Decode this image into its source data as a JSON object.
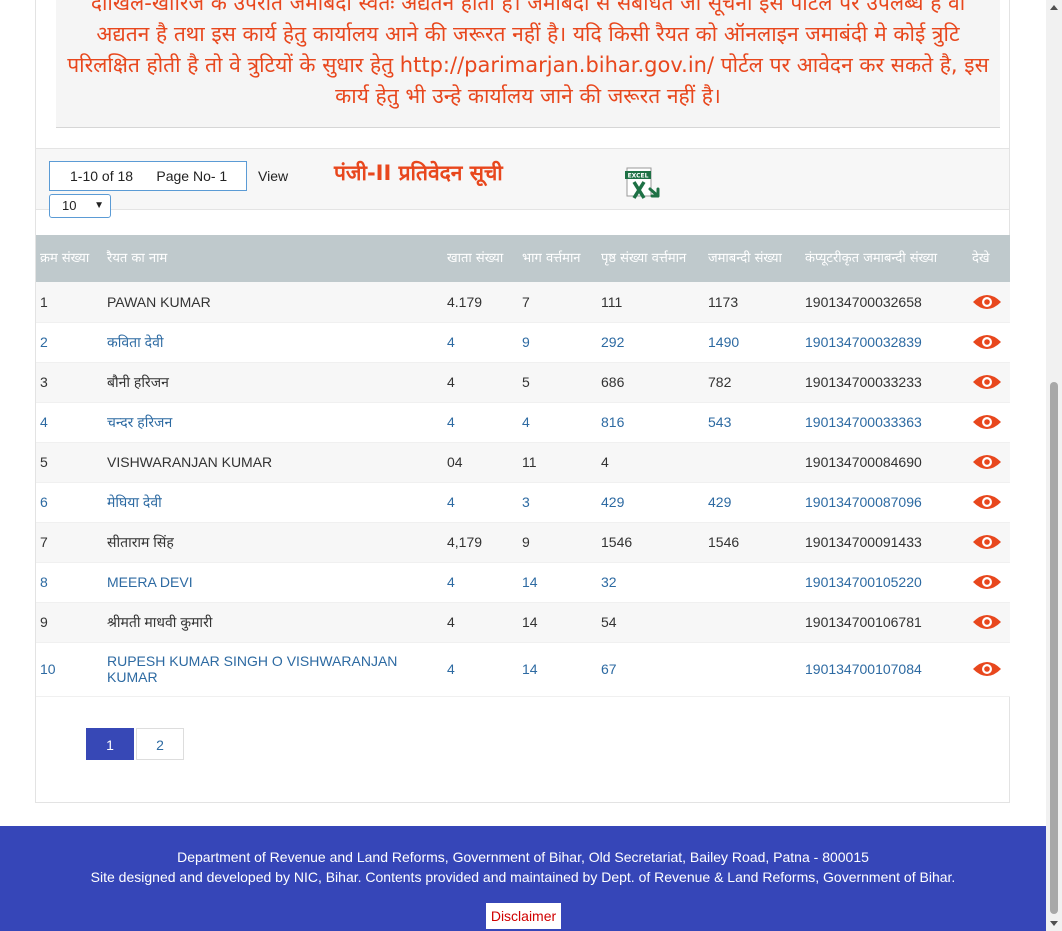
{
  "notice": {
    "text": "दाखिल-खारिज के उपरांत जमाबंदी स्वतः अद्यतन होती है। जमाबंदी से संबंधित जो सूचना इस पोर्टल पर उपलब्ध है वो अद्यतन है तथा इस कार्य हेतु कार्यालय आने की जरूरत नहीं है। यदि किसी रैयत को ऑनलाइन जमाबंदी मे कोई त्रुटि परिलक्षित होती है तो वे त्रुटियों के सुधार हेतु http://parimarjan.bihar.gov.in/ पोर्टल पर आवेदन कर सकते है, इस कार्य हेतु भी उन्हे कार्यालय जाने की जरूरत नहीं है।"
  },
  "toolbar": {
    "range_text": "1-10 of 18      Page No- 1",
    "view_label": "View",
    "page_size": "10",
    "report_title": "पंजी-II प्रतिवेदन सूची",
    "excel_icon": "excel-export-icon"
  },
  "table": {
    "headers": {
      "serial": "क्रम संख्या",
      "name": "रैयत का नाम",
      "khata": "खाता संख्या",
      "bhag": "भाग वर्त्तमान",
      "page": "पृष्ठ संख्या वर्त्तमान",
      "jamabandi": "जमाबन्दी संख्या",
      "computerized": "कंप्यूटरीकृत जमाबन्दी संख्या",
      "view": "देखे"
    },
    "view_icon": "eye-icon",
    "rows": [
      {
        "serial": "1",
        "name": "PAWAN KUMAR",
        "khata": "4.179",
        "bhag": "7",
        "page": "111",
        "jamabandi": "1173",
        "computerized": "190134700032658"
      },
      {
        "serial": "2",
        "name": "कविता देवी",
        "khata": "4",
        "bhag": "9",
        "page": "292",
        "jamabandi": "1490",
        "computerized": "190134700032839"
      },
      {
        "serial": "3",
        "name": "बौनी हरिजन",
        "khata": "4",
        "bhag": "5",
        "page": "686",
        "jamabandi": "782",
        "computerized": "190134700033233"
      },
      {
        "serial": "4",
        "name": "चन्दर हरिजन",
        "khata": "4",
        "bhag": "4",
        "page": "816",
        "jamabandi": "543",
        "computerized": "190134700033363"
      },
      {
        "serial": "5",
        "name": "VISHWARANJAN KUMAR",
        "khata": "04",
        "bhag": "11",
        "page": "4",
        "jamabandi": "",
        "computerized": "190134700084690"
      },
      {
        "serial": "6",
        "name": "मेघिया देवी",
        "khata": "4",
        "bhag": "3",
        "page": "429",
        "jamabandi": "429",
        "computerized": "190134700087096"
      },
      {
        "serial": "7",
        "name": "सीताराम सिंह",
        "khata": "4,179",
        "bhag": "9",
        "page": "1546",
        "jamabandi": "1546",
        "computerized": "190134700091433"
      },
      {
        "serial": "8",
        "name": "MEERA DEVI",
        "khata": "4",
        "bhag": "14",
        "page": "32",
        "jamabandi": "",
        "computerized": "190134700105220"
      },
      {
        "serial": "9",
        "name": "श्रीमती माधवी कुमारी",
        "khata": "4",
        "bhag": "14",
        "page": "54",
        "jamabandi": "",
        "computerized": "190134700106781"
      },
      {
        "serial": "10",
        "name": "RUPESH KUMAR SINGH O VISHWARANJAN KUMAR",
        "khata": "4",
        "bhag": "14",
        "page": "67",
        "jamabandi": "",
        "computerized": "190134700107084"
      }
    ]
  },
  "pagination": {
    "pages": [
      "1",
      "2"
    ],
    "active": "1"
  },
  "footer": {
    "line1": "Department of Revenue and Land Reforms, Government of Bihar, Old Secretariat, Bailey Road, Patna - 800015",
    "line2": "Site designed and developed by NIC, Bihar. Contents provided and maintained by Dept. of Revenue & Land Reforms, Government of Bihar.",
    "disclaimer": "Disclaimer"
  },
  "colors": {
    "accent_orange": "#e8471d",
    "header_gray": "#bfc9cc",
    "link_blue": "#2d6aa2",
    "footer_blue": "#3646b8",
    "eye_red": "#e8471d"
  }
}
